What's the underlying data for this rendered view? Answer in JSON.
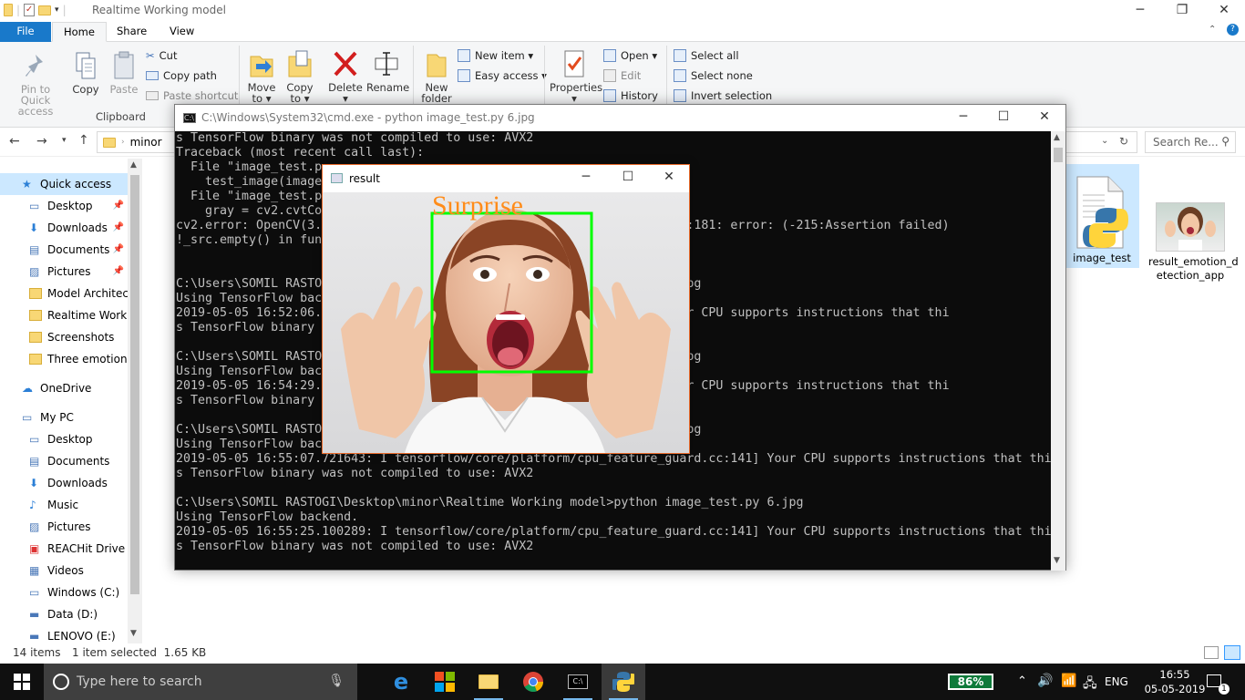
{
  "explorer": {
    "title": "Realtime Working model",
    "tabs": [
      "File",
      "Home",
      "Share",
      "View"
    ],
    "ribbon": {
      "clipboard": {
        "pin": "Pin to Quick",
        "pin2": "access",
        "copy": "Copy",
        "paste": "Paste",
        "cut": "Cut",
        "copy_path": "Copy path",
        "paste_shortcut": "Paste shortcut",
        "group": "Clipboard"
      },
      "organize": {
        "move": "Move",
        "move2": "to ▾",
        "copy_to": "Copy",
        "copy_to2": "to ▾",
        "delete": "Delete",
        "delete2": "▾",
        "rename": "Rename"
      },
      "new": {
        "new_folder": "New",
        "new_folder2": "folder",
        "new_item": "New item ▾",
        "easy_access": "Easy access ▾"
      },
      "open": {
        "properties": "Properties",
        "properties2": "▾",
        "open": "Open ▾",
        "edit": "Edit",
        "history": "History"
      },
      "select": {
        "select_all": "Select all",
        "select_none": "Select none",
        "invert": "Invert selection"
      }
    },
    "address_crumb": "minor",
    "search_placeholder": "Search Re...",
    "nav": [
      {
        "label": "Quick access",
        "selected": true
      },
      {
        "label": "Desktop",
        "pinned": true
      },
      {
        "label": "Downloads",
        "pinned": true
      },
      {
        "label": "Documents",
        "pinned": true
      },
      {
        "label": "Pictures",
        "pinned": true
      },
      {
        "label": "Model Architect"
      },
      {
        "label": "Realtime Workin"
      },
      {
        "label": "Screenshots"
      },
      {
        "label": "Three emotion t"
      },
      {
        "label": "OneDrive"
      },
      {
        "label": "My PC"
      },
      {
        "label": "Desktop"
      },
      {
        "label": "Documents"
      },
      {
        "label": "Downloads"
      },
      {
        "label": "Music"
      },
      {
        "label": "Pictures"
      },
      {
        "label": "REACHit Drive"
      },
      {
        "label": "Videos"
      },
      {
        "label": "Windows (C:)"
      },
      {
        "label": "Data (D:)"
      },
      {
        "label": "LENOVO (E:)"
      }
    ],
    "files": [
      {
        "name": "image_test",
        "selected": true
      },
      {
        "name": "result_emotion_d",
        "name2": "etection_app"
      }
    ],
    "status": {
      "count": "14 items",
      "selection": "1 item selected  1.65 KB"
    }
  },
  "cmd": {
    "title": "C:\\Windows\\System32\\cmd.exe - python  image_test.py 6.jpg",
    "lines": [
      "s TensorFlow binary was not compiled to use: AVX2",
      "Traceback (most recent call last):",
      "  File \"image_test.p",
      "    test_image(image",
      "  File \"image_test.p",
      "    gray = cv2.cvtCo",
      "cv2.error: OpenCV(3.                                     src\\color.cpp:181: error: (-215:Assertion failed)",
      "!_src.empty() in fun",
      "",
      "",
      "C:\\Users\\SOMIL RASTO                                     e_test.py 4.jpg",
      "Using TensorFlow bac",
      "2019-05-05 16:52:06.                                     d.cc:141] Your CPU supports instructions that thi",
      "s TensorFlow binary ",
      "",
      "C:\\Users\\SOMIL RASTO                                     e_test.py 4.jpg",
      "Using TensorFlow bac",
      "2019-05-05 16:54:29.                                     d.cc:141] Your CPU supports instructions that thi",
      "s TensorFlow binary ",
      "",
      "C:\\Users\\SOMIL RASTO                                     e_test.py 4.jpg",
      "Using TensorFlow bac",
      "2019-05-05 16:55:07.721643: I tensorflow/core/platform/cpu_feature_guard.cc:141] Your CPU supports instructions that thi",
      "s TensorFlow binary was not compiled to use: AVX2",
      "",
      "C:\\Users\\SOMIL RASTOGI\\Desktop\\minor\\Realtime Working model>python image_test.py 6.jpg",
      "Using TensorFlow backend.",
      "2019-05-05 16:55:25.100289: I tensorflow/core/platform/cpu_feature_guard.cc:141] Your CPU supports instructions that thi",
      "s TensorFlow binary was not compiled to use: AVX2"
    ]
  },
  "result": {
    "title": "result",
    "label": "Surprise",
    "label_color": "#ff8c1a",
    "box_color": "#00ff00"
  },
  "taskbar": {
    "search_placeholder": "Type here to search",
    "battery": "86%",
    "lang": "ENG",
    "time": "16:55",
    "date": "05-05-2019",
    "notifications": "1"
  }
}
